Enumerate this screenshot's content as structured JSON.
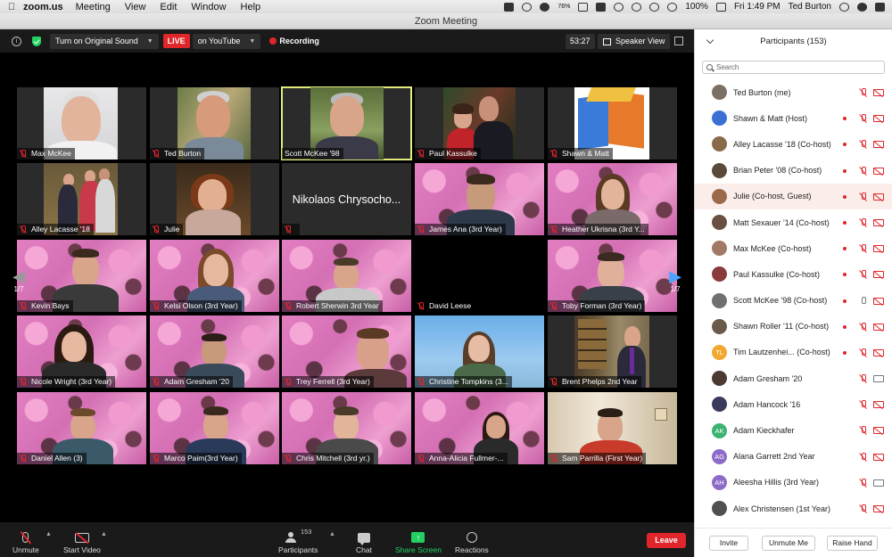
{
  "menubar": {
    "app": "zoom.us",
    "menus": [
      "Meeting",
      "View",
      "Edit",
      "Window",
      "Help"
    ],
    "battery_percent": "76%",
    "battery_level": "100%",
    "time": "Fri 1:49 PM",
    "user": "Ted Burton"
  },
  "window": {
    "title": "Zoom Meeting"
  },
  "topbar": {
    "original_sound": "Turn on Original Sound",
    "live": "LIVE",
    "youtube": "on YouTube",
    "recording": "Recording",
    "timer": "53:27",
    "view": "Speaker View"
  },
  "pages": {
    "left": "1/7",
    "right": "1/7"
  },
  "tiles": [
    {
      "name": "Max McKee"
    },
    {
      "name": "Ted Burton"
    },
    {
      "name": "Scott McKee '98"
    },
    {
      "name": "Paul Kassulke"
    },
    {
      "name": "Shawn & Matt"
    },
    {
      "name": "Alley Lacasse '18"
    },
    {
      "name": "Julie"
    },
    {
      "name": "",
      "bigname": "Nikolaos Chrysocho..."
    },
    {
      "name": "James Ana (3rd Year)"
    },
    {
      "name": "Heather Ukrisna (3rd Y..."
    },
    {
      "name": "Kevin Bays"
    },
    {
      "name": "Kelsi Olson (3rd Year)"
    },
    {
      "name": "Robert Sherwin 3rd Year"
    },
    {
      "name": "David Leese"
    },
    {
      "name": "Toby Forman (3rd Year)"
    },
    {
      "name": "Nicole Wright (3rd Year)"
    },
    {
      "name": "Adam Gresham '20"
    },
    {
      "name": "Trey Ferrell (3rd Year)"
    },
    {
      "name": "Christine Tompkins (3..."
    },
    {
      "name": "Brent Phelps 2nd Year"
    },
    {
      "name": "Daniel Allen (3)"
    },
    {
      "name": "Marco Paim(3rd Year)"
    },
    {
      "name": "Chris Mitchell (3rd yr.)"
    },
    {
      "name": "Anna-Alicia Fullmer-..."
    },
    {
      "name": "Sam Parrilla (First Year)"
    }
  ],
  "toolbar": {
    "unmute": "Unmute",
    "start_video": "Start Video",
    "participants": "Participants",
    "participants_count": "153",
    "chat": "Chat",
    "share_screen": "Share Screen",
    "reactions": "Reactions",
    "leave": "Leave"
  },
  "panel": {
    "title": "Participants (153)",
    "search_placeholder": "Search",
    "participants": [
      {
        "name": "Ted Burton (me)",
        "initials": "",
        "avatar_color": "#7a7064",
        "rec": false,
        "mic": "muted",
        "cam": "muted"
      },
      {
        "name": "Shawn & Matt (Host)",
        "initials": "",
        "avatar_color": "#3b6fd4",
        "rec": true,
        "mic": "muted",
        "cam": "muted"
      },
      {
        "name": "Alley Lacasse '18  (Co-host)",
        "initials": "",
        "avatar_color": "#8a6a4a",
        "rec": true,
        "mic": "muted",
        "cam": "muted"
      },
      {
        "name": "Brian Peter '08 (Co-host)",
        "initials": "",
        "avatar_color": "#5a4a3a",
        "rec": true,
        "mic": "muted",
        "cam": "muted"
      },
      {
        "name": "Julie (Co-host, Guest)",
        "initials": "",
        "avatar_color": "#9a6a4a",
        "rec": true,
        "mic": "muted",
        "cam": "muted"
      },
      {
        "name": "Matt Sexauer '14 (Co-host)",
        "initials": "",
        "avatar_color": "#6a5040",
        "rec": true,
        "mic": "muted",
        "cam": "muted"
      },
      {
        "name": "Max McKee (Co-host)",
        "initials": "",
        "avatar_color": "#a07a64",
        "rec": true,
        "mic": "muted",
        "cam": "muted"
      },
      {
        "name": "Paul Kassulke (Co-host)",
        "initials": "",
        "avatar_color": "#8a3a3a",
        "rec": true,
        "mic": "muted",
        "cam": "muted"
      },
      {
        "name": "Scott McKee '98 (Co-host)",
        "initials": "",
        "avatar_color": "#707070",
        "rec": true,
        "mic": "on",
        "cam": "muted"
      },
      {
        "name": "Shawn Roller '11 (Co-host)",
        "initials": "",
        "avatar_color": "#6a5a4a",
        "rec": true,
        "mic": "muted",
        "cam": "muted"
      },
      {
        "name": "Tim Lautzenhei...  (Co-host)",
        "initials": "TL",
        "avatar_color": "#f0a830",
        "rec": true,
        "mic": "muted",
        "cam": "muted"
      },
      {
        "name": "Adam Gresham '20",
        "initials": "",
        "avatar_color": "#4a3a30",
        "rec": false,
        "mic": "muted",
        "cam": "on"
      },
      {
        "name": "Adam Hancock '16",
        "initials": "",
        "avatar_color": "#3a3a5a",
        "rec": false,
        "mic": "muted",
        "cam": "muted"
      },
      {
        "name": "Adam Kieckhafer",
        "initials": "AK",
        "avatar_color": "#3cb371",
        "rec": false,
        "mic": "muted",
        "cam": "muted"
      },
      {
        "name": "Alana Garrett 2nd Year",
        "initials": "AG",
        "avatar_color": "#8e6bc8",
        "rec": false,
        "mic": "muted",
        "cam": "muted"
      },
      {
        "name": "Aleesha Hillis (3rd Year)",
        "initials": "AH",
        "avatar_color": "#8e6bc8",
        "rec": false,
        "mic": "muted",
        "cam": "on"
      },
      {
        "name": "Alex Christensen (1st Year)",
        "initials": "",
        "avatar_color": "#505050",
        "rec": false,
        "mic": "muted",
        "cam": "muted"
      }
    ],
    "invite": "Invite",
    "unmute_me": "Unmute Me",
    "raise_hand": "Raise Hand"
  },
  "colors": {
    "live_red": "#e0262b",
    "share_green": "#23d160",
    "active_speaker": "#e4ec7c",
    "page_arrow": "#4aa3ff"
  }
}
